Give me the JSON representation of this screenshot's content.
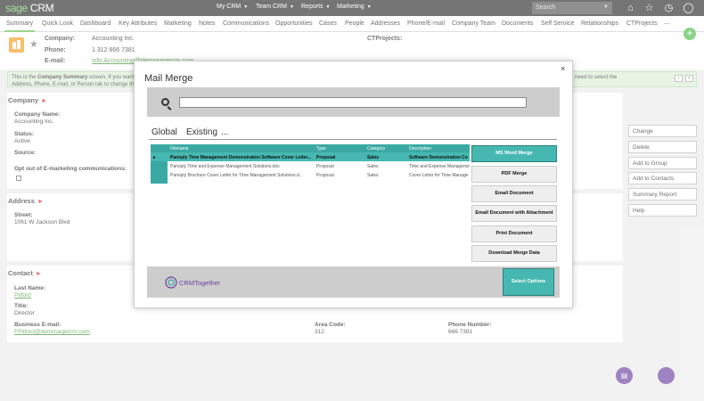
{
  "topbar": {
    "logo_brand": "sage",
    "logo_product": "CRM",
    "menus": [
      "My CRM",
      "Team CRM",
      "Reports",
      "Marketing"
    ],
    "search_placeholder": "Search",
    "icons": [
      "home-icon",
      "star-icon",
      "clock-icon",
      "user-icon"
    ]
  },
  "tabs": [
    "Summary",
    "Quick Look",
    "Dashboard",
    "Key Attributes",
    "Marketing",
    "Notes",
    "Communications",
    "Opportunities",
    "Cases",
    "People",
    "Addresses",
    "Phone/E-mail",
    "Company Team",
    "Documents",
    "Self Service",
    "Relationships",
    "CTProjects",
    "⋯"
  ],
  "header": {
    "company_label": "Company:",
    "company_value": "Accounting Inc.",
    "phone_label": "Phone:",
    "phone_value": "1 312 666 7381",
    "email_label": "E-mail:",
    "email_value": "info.Accounting@demosagecrm.com",
    "ctprojects_label": "CTProjects:"
  },
  "infobar": {
    "text_line1_left": "This is the",
    "text_line1_bold": "Company Summary",
    "text_line1_rest": "screen. If you want to",
    "text_line2": "Address, Phone, E-mail, or Person tab to change this",
    "text_right": "need to select the"
  },
  "company_section": {
    "title": "Company",
    "name_label": "Company Name:",
    "name_value": "Accounting Inc.",
    "status_label": "Status:",
    "status_value": "Active",
    "source_label": "Source:",
    "optout_label": "Opt out of E-marketing communications:"
  },
  "address_section": {
    "title": "Address",
    "street_label": "Street:",
    "street_value": "1061 W Jackson Blvd"
  },
  "contact_section": {
    "title": "Contact",
    "lastname_label": "Last Name:",
    "lastname_value": "Pitford",
    "title_label": "Title:",
    "title_value": "Director",
    "email_label": "Business E-mail:",
    "email_value": "FPitford@demosagecrm.com",
    "area_label": "Area Code:",
    "area_value": "312",
    "phone_label": "Phone Number:",
    "phone_value": "666 7381"
  },
  "actions": [
    "Change",
    "Delete",
    "Add to Group",
    "Add to Contacts",
    "Summary Report",
    "Help"
  ],
  "modal": {
    "title": "Mail Merge",
    "close": "×",
    "tabs": [
      "Global",
      "Existing",
      "..."
    ],
    "columns": [
      "Filename",
      "Type",
      "Category",
      "Description"
    ],
    "rows": [
      [
        "Panoply Time Management Demonstration Software Cover Letter...",
        "Proposal",
        "Sales",
        "Software Demonstration Co"
      ],
      [
        "Panoply Time and Expense Management Solutions.doc",
        "Proposal",
        "Sales",
        "Time and Expense Manageme"
      ],
      [
        "Panoply Brochure Cover Letter for Time Management Solutions.d...",
        "Proposal",
        "Sales",
        "Cover Letter for Time Manage"
      ]
    ],
    "buttons": [
      "MS Word Merge",
      "PDF Merge",
      "Email Document",
      "Email Document with Attachment",
      "Print Document",
      "Download Merge Data"
    ],
    "brand": "CRMTogether",
    "select_options": "Select Options"
  },
  "colors": {
    "accent_green": "#6bbf4e",
    "teal": "#46b8b1",
    "purple": "#6b3fa0",
    "red_marker": "#d9231e"
  }
}
